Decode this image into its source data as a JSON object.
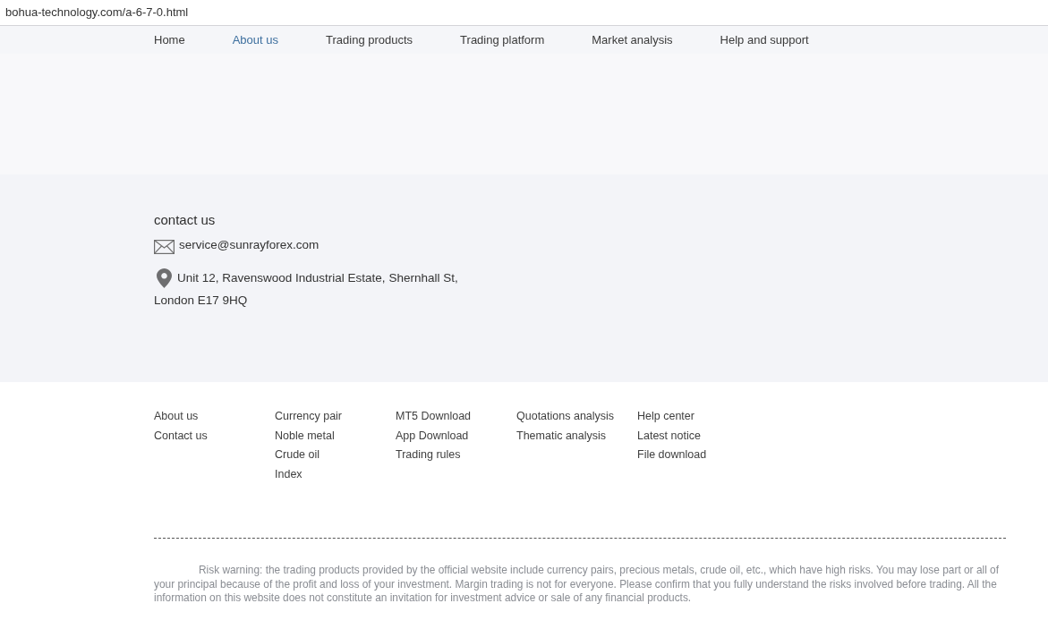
{
  "address_bar": {
    "url": "bohua-technology.com/a-6-7-0.html"
  },
  "nav": {
    "items": [
      {
        "label": "Home",
        "selected": false
      },
      {
        "label": "About us",
        "selected": true
      },
      {
        "label": "Trading products",
        "selected": false
      },
      {
        "label": "Trading platform",
        "selected": false
      },
      {
        "label": "Market analysis",
        "selected": false
      },
      {
        "label": "Help and support",
        "selected": false
      }
    ]
  },
  "contact": {
    "heading": "contact us",
    "email": "service@sunrayforex.com",
    "address_lines": [
      "Unit 12, Ravenswood Industrial Estate, Shernhall St,",
      "London E17 9HQ"
    ]
  },
  "footer": {
    "columns": [
      {
        "links": [
          "About us",
          "Contact us"
        ]
      },
      {
        "links": [
          "Currency pair",
          "Noble metal",
          "Crude oil",
          "Index"
        ]
      },
      {
        "links": [
          "MT5 Download",
          "App Download",
          "Trading rules"
        ]
      },
      {
        "links": [
          "Quotations analysis",
          "Thematic analysis"
        ]
      },
      {
        "links": [
          "Help center",
          "Latest notice",
          "File download"
        ]
      }
    ],
    "risk_warning": "Risk warning: the trading products provided by the official website include currency pairs, precious metals, crude oil, etc., which have high risks. You may lose part or all of your principal because of the profit and loss of your investment. Margin trading is not for everyone. Please confirm that you fully understand the risks involved before trading. All the information on this website does not constitute an invitation for investment advice or sale of any financial products."
  }
}
